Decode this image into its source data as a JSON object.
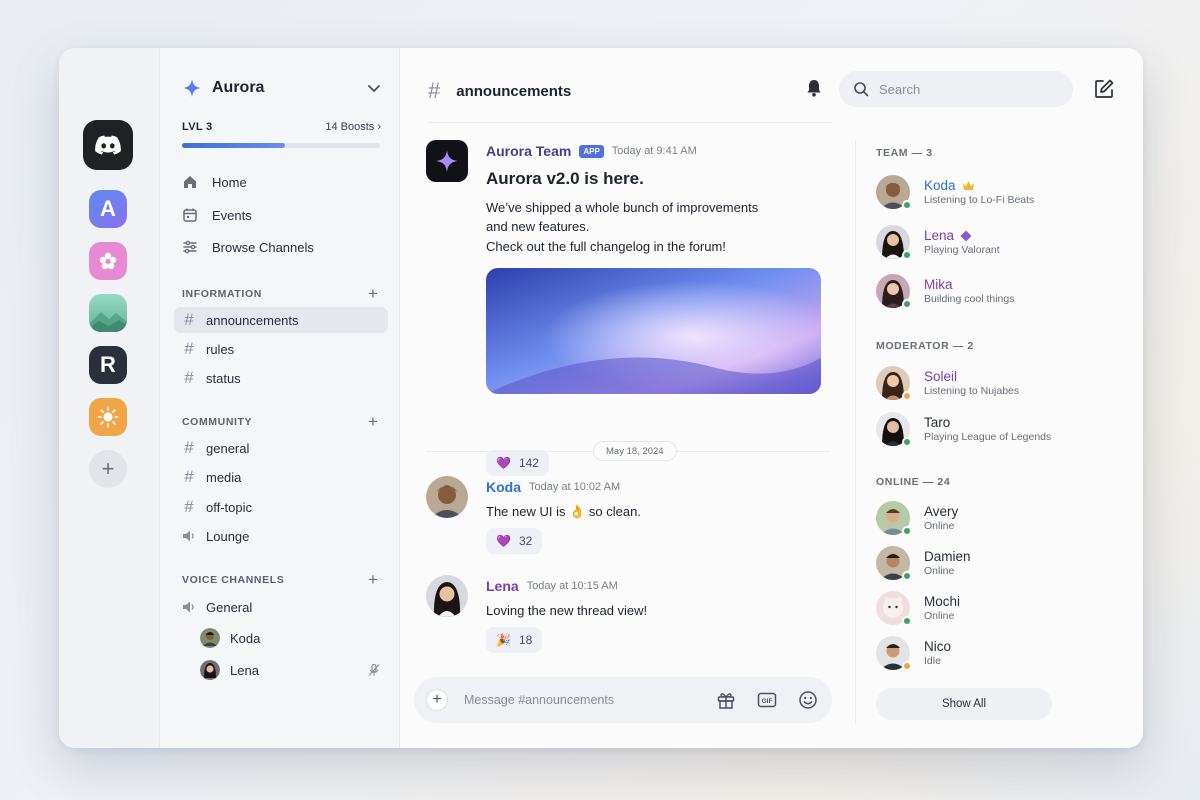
{
  "server": {
    "name": "Aurora",
    "level": "LVL 3",
    "boosts": "14 Boosts",
    "boost_progress": 0.52
  },
  "servers": [
    {
      "name": "Discord",
      "icon": "discord-icon",
      "color": "#1f2125"
    },
    {
      "name": "A",
      "letter": "A",
      "color": "#6a7ff2"
    },
    {
      "name": "Flower",
      "icon": "flower-icon",
      "color": "#e58bd2"
    },
    {
      "name": "Landscape",
      "icon": "mountain-icon",
      "color": "#7fc9b0"
    },
    {
      "name": "R",
      "letter": "R",
      "color": "#2a2f3b"
    },
    {
      "name": "Sun",
      "icon": "sun-icon",
      "color": "#f0a546"
    }
  ],
  "nav": {
    "home": "Home",
    "events": "Events",
    "browse": "Browse Channels"
  },
  "categories": {
    "information": {
      "label": "INFORMATION",
      "channels": [
        "announcements",
        "rules",
        "status"
      ]
    },
    "community": {
      "label": "COMMUNITY",
      "channels": [
        "general",
        "media",
        "off-topic"
      ],
      "voice": "Lounge"
    },
    "voice": {
      "label": "VOICE CHANNELS",
      "channel": "General",
      "users": [
        "Koda",
        "Lena"
      ]
    }
  },
  "chat": {
    "channel": "announcements",
    "search_placeholder": "Search",
    "composer_placeholder": "Message #announcements",
    "date_divider": "May 18, 2024",
    "messages": [
      {
        "author": "Aurora Team",
        "badge": "APP",
        "time": "Today at 9:41 AM",
        "color": "#4b3b8c",
        "title": "Aurora v2.0 is here.",
        "lines": [
          "We’ve shipped a whole bunch of improvements",
          "and new features.",
          "Check out the full changelog in the forum!"
        ],
        "reaction": {
          "emoji": "💜",
          "count": "142"
        }
      },
      {
        "author": "Koda",
        "time": "Today at 10:02 AM",
        "color": "#2f6fd0",
        "text": "The new UI is 👌 so clean.",
        "reaction": {
          "emoji": "💜",
          "count": "32"
        }
      },
      {
        "author": "Lena",
        "time": "Today at 10:15 AM",
        "color": "#7a3fa6",
        "text": "Loving the new thread view!",
        "reaction": {
          "emoji": "🎉",
          "count": "18"
        }
      }
    ]
  },
  "members": {
    "team": {
      "label": "TEAM — 3",
      "list": [
        {
          "name": "Koda",
          "status": "Listening to Lo-Fi Beats",
          "color": "#2f6fd0",
          "presence": "online",
          "badge": "crown"
        },
        {
          "name": "Lena",
          "status": "Playing Valorant",
          "color": "#7a3fa6",
          "presence": "online",
          "badge": "diamond"
        },
        {
          "name": "Mika",
          "status": "Building cool things",
          "color": "#7a3fa6",
          "presence": "online"
        }
      ]
    },
    "moderator": {
      "label": "MODERATOR — 2",
      "list": [
        {
          "name": "Soleil",
          "status": "Listening to Nujabes",
          "color": "#7a3fa6",
          "presence": "idle"
        },
        {
          "name": "Taro",
          "status": "Playing League of Legends",
          "color": "#2a2f3b",
          "presence": "online"
        }
      ]
    },
    "online": {
      "label": "ONLINE — 24",
      "list": [
        {
          "name": "Avery",
          "status": "Online",
          "presence": "online"
        },
        {
          "name": "Damien",
          "status": "Online",
          "presence": "online"
        },
        {
          "name": "Mochi",
          "status": "Online",
          "presence": "online"
        },
        {
          "name": "Nico",
          "status": "Idle",
          "presence": "idle"
        }
      ]
    },
    "show_all": "Show All"
  },
  "colors": {
    "online": "#3ba55d",
    "idle": "#f0a546",
    "accent": "#4f6fe5"
  }
}
